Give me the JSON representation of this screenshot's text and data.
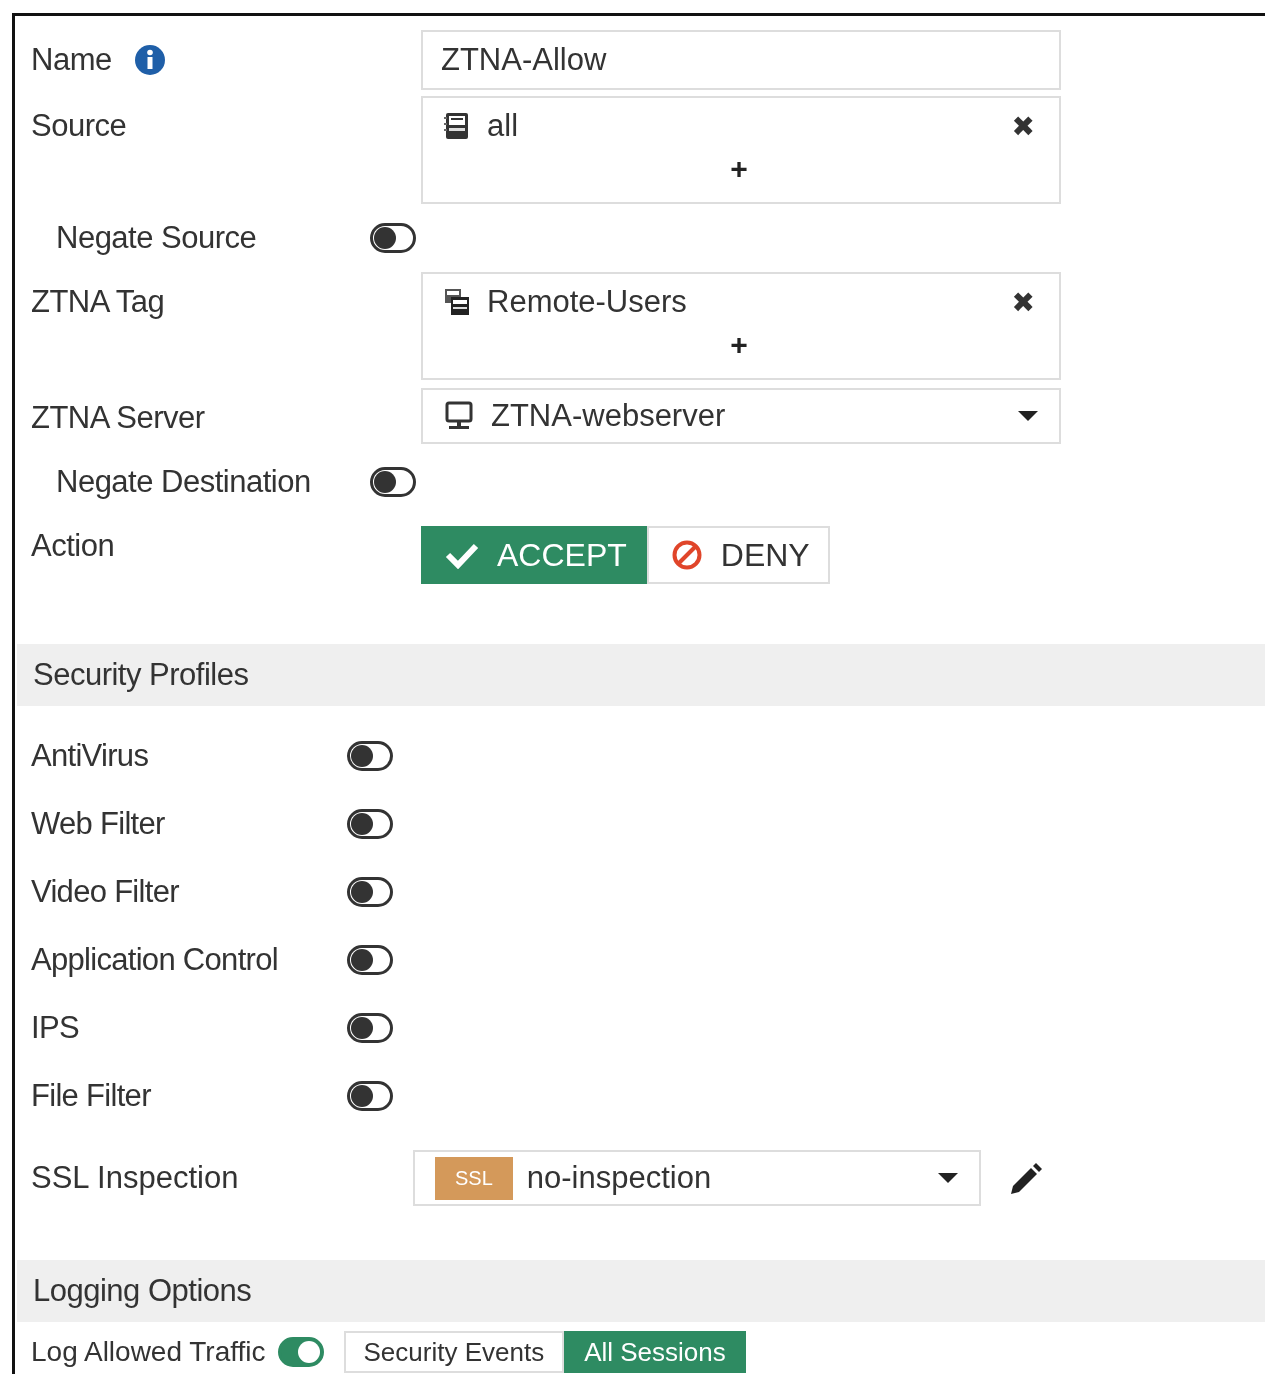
{
  "rows": [
    {
      "kind": "input",
      "label": "Name",
      "info": true,
      "value": "ZTNA-Allow"
    },
    {
      "kind": "multi",
      "label": "Source",
      "entries": [
        {
          "kind": "address",
          "text": "all"
        }
      ],
      "add": "+",
      "remove": "✖"
    },
    {
      "kind": "toggle",
      "label": "Negate Source",
      "on": false
    },
    {
      "kind": "multi",
      "label": "ZTNA Tag",
      "entries": [
        {
          "kind": "group",
          "text": "Remote-Users"
        }
      ],
      "add": "+",
      "remove": "✖"
    },
    {
      "kind": "dropdown",
      "label": "ZTNA Server",
      "value": "ZTNA-webserver"
    },
    {
      "kind": "toggle",
      "label": "Negate Destination",
      "on": false
    },
    {
      "kind": "action",
      "label": "Action",
      "options": [
        {
          "kind": "accept",
          "label": "ACCEPT",
          "selected": true
        },
        {
          "kind": "deny",
          "label": "DENY",
          "selected": false
        }
      ]
    }
  ],
  "security_profiles": {
    "title": "Security Profiles",
    "profiles": [
      {
        "label": "AntiVirus",
        "on": false
      },
      {
        "label": "Web Filter",
        "on": false
      },
      {
        "label": "Video Filter",
        "on": false
      },
      {
        "label": "Application Control",
        "on": false
      },
      {
        "label": "IPS",
        "on": false
      },
      {
        "label": "File Filter",
        "on": false
      }
    ],
    "ssl": {
      "label": "SSL Inspection",
      "badge": "SSL",
      "value": "no-inspection"
    }
  },
  "logging": {
    "title": "Logging Options",
    "label": "Log Allowed Traffic",
    "on": true,
    "options": [
      {
        "label": "Security Events",
        "selected": false
      },
      {
        "label": "All Sessions",
        "selected": true
      }
    ]
  }
}
